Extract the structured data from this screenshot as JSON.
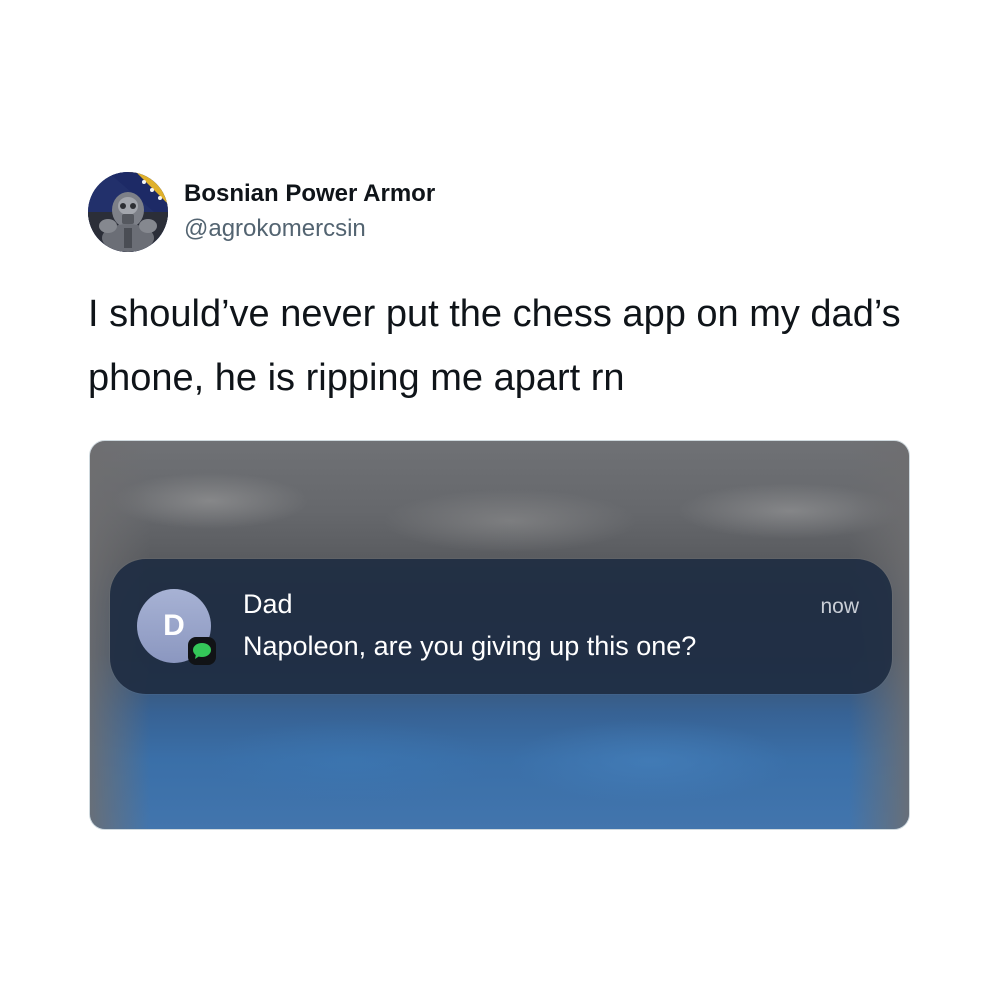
{
  "tweet": {
    "author": {
      "display_name": "Bosnian Power Armor",
      "handle": "@agrokomercsin",
      "avatar_icon": "power-armor-avatar"
    },
    "text": "I should’ve never put the chess app on my dad’s phone, he is ripping me apart rn"
  },
  "media": {
    "notification": {
      "contact_initial": "D",
      "sender": "Dad",
      "time": "now",
      "message": "Napoleon, are you giving up this one?",
      "app_icon": "messages-icon",
      "colors": {
        "banner": "#1e2c42",
        "avatar": "#98a3cb",
        "app_badge": "#34c759"
      }
    }
  }
}
